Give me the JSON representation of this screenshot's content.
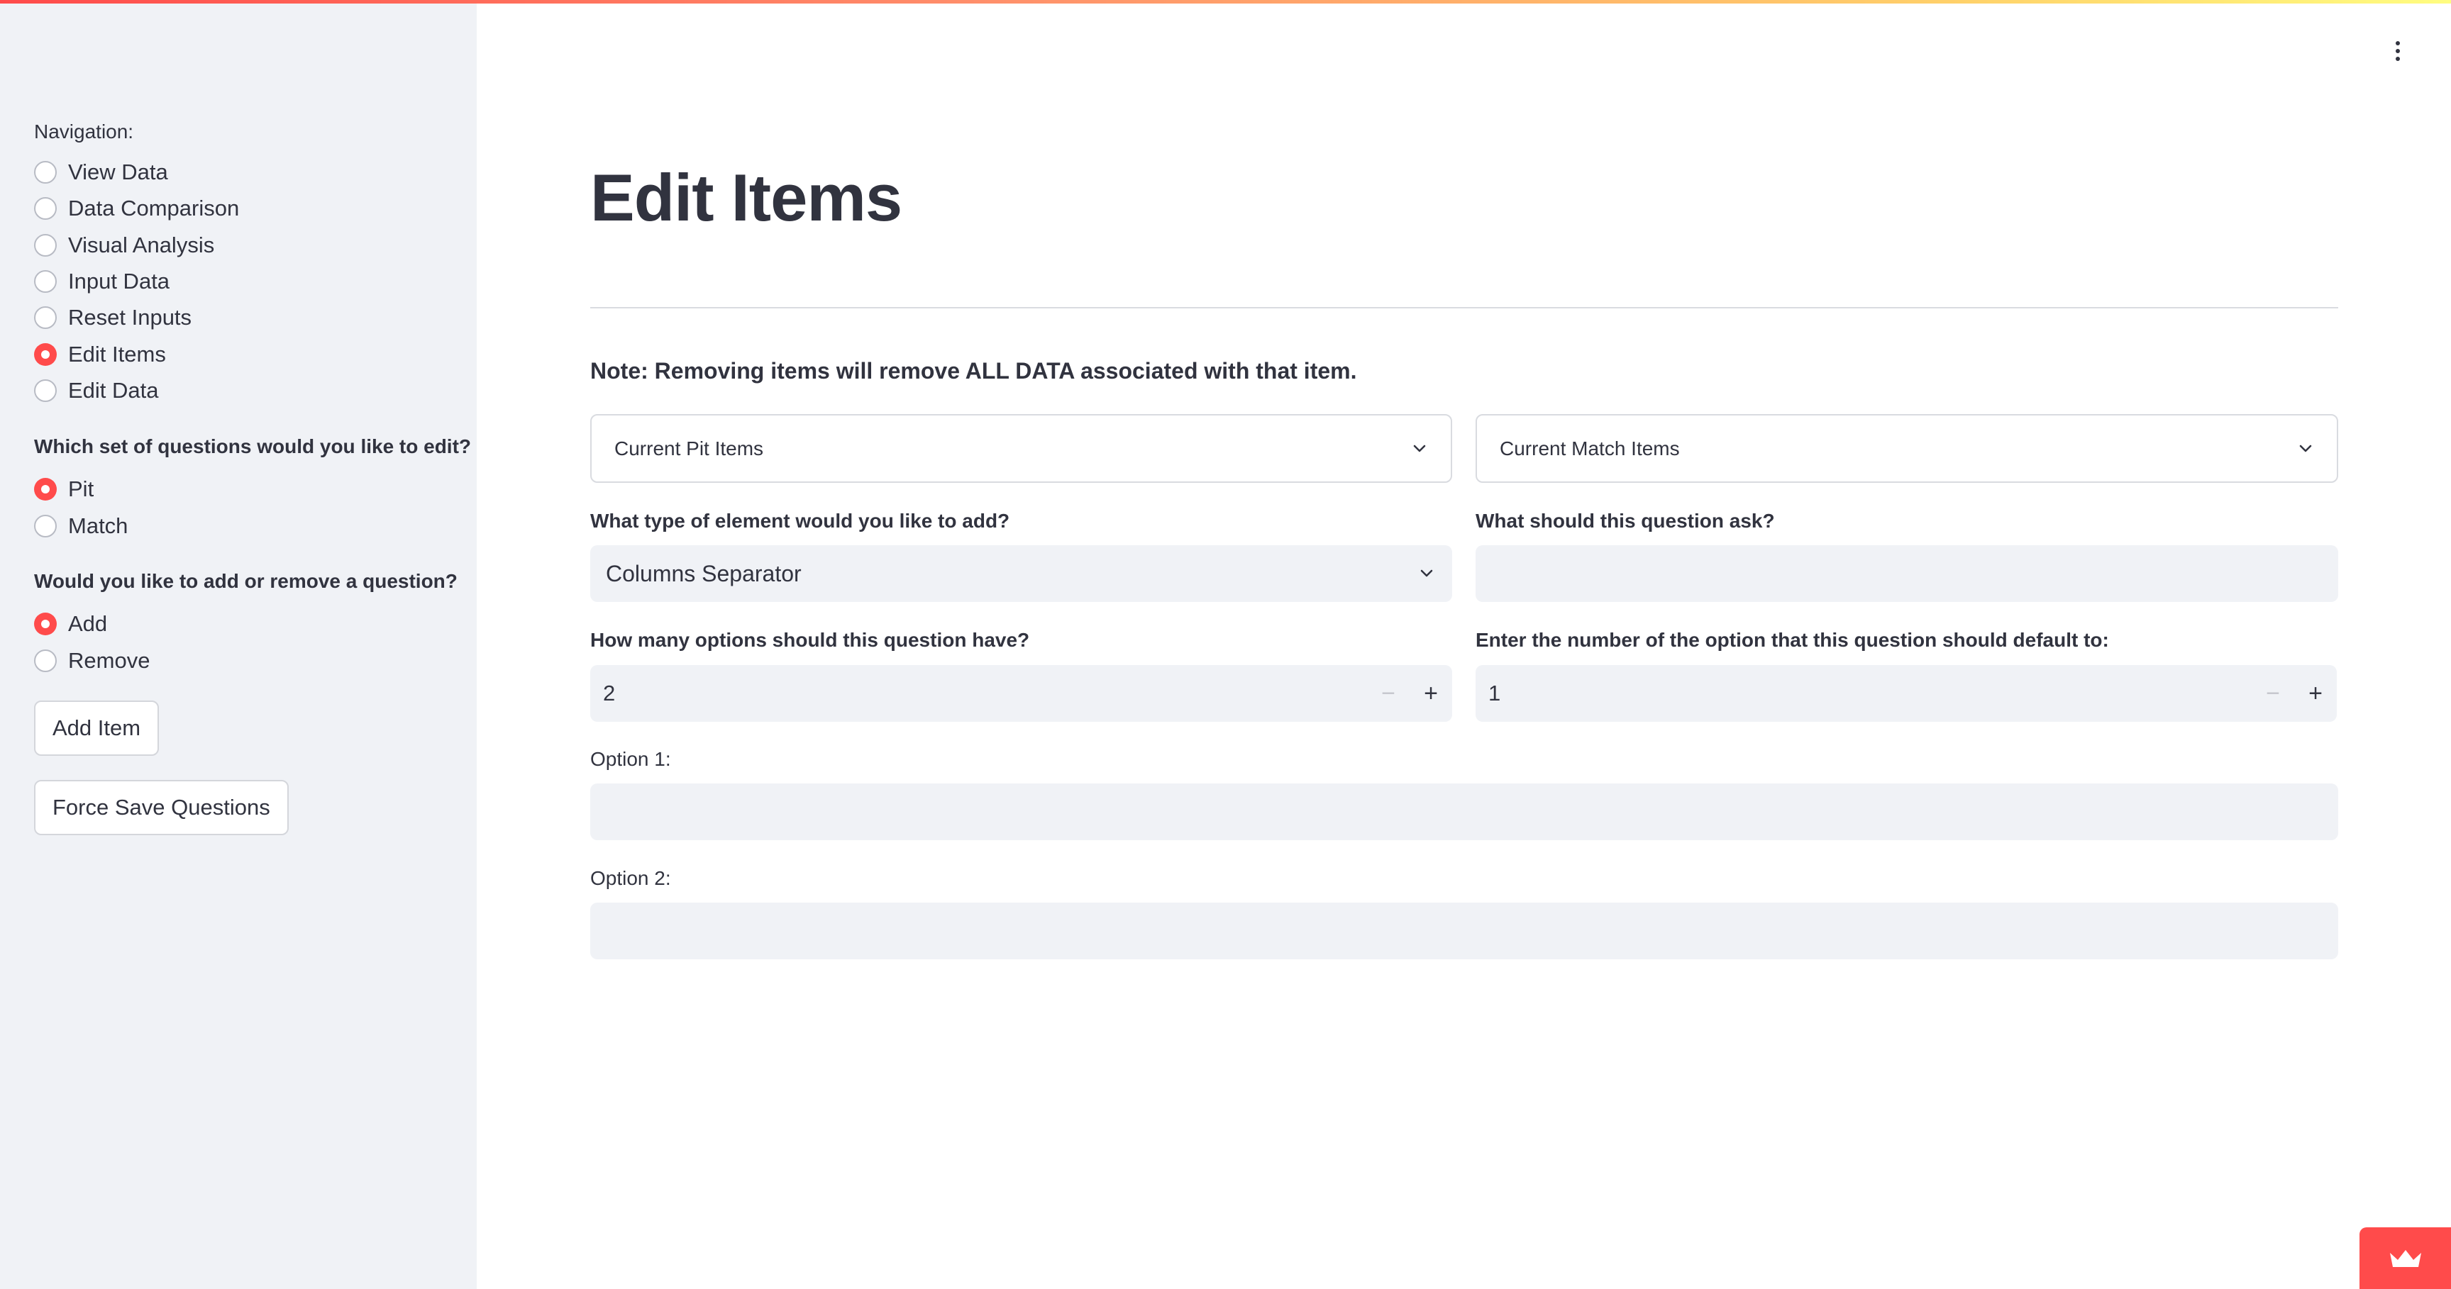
{
  "sidebar": {
    "navigation_label": "Navigation:",
    "nav_items": [
      {
        "label": "View Data",
        "checked": false
      },
      {
        "label": "Data Comparison",
        "checked": false
      },
      {
        "label": "Visual Analysis",
        "checked": false
      },
      {
        "label": "Input Data",
        "checked": false
      },
      {
        "label": "Reset Inputs",
        "checked": false
      },
      {
        "label": "Edit Items",
        "checked": true
      },
      {
        "label": "Edit Data",
        "checked": false
      }
    ],
    "question_set_label": "Which set of questions would you like to edit?",
    "question_set_options": [
      {
        "label": "Pit",
        "checked": true
      },
      {
        "label": "Match",
        "checked": false
      }
    ],
    "add_remove_label": "Would you like to add or remove a question?",
    "add_remove_options": [
      {
        "label": "Add",
        "checked": true
      },
      {
        "label": "Remove",
        "checked": false
      }
    ],
    "add_item_button": "Add Item",
    "force_save_button": "Force Save Questions"
  },
  "main": {
    "title": "Edit Items",
    "note": "Note: Removing items will remove ALL DATA associated with that item.",
    "expanders": {
      "pit": "Current Pit Items",
      "match": "Current Match Items"
    },
    "element_type": {
      "label": "What type of element would you like to add?",
      "value": "Columns Separator"
    },
    "question_ask": {
      "label": "What should this question ask?",
      "value": ""
    },
    "num_options": {
      "label": "How many options should this question have?",
      "value": "2"
    },
    "default_option": {
      "label": "Enter the number of the option that this question should default to:",
      "value": "1"
    },
    "option1": {
      "label": "Option 1:",
      "value": ""
    },
    "option2": {
      "label": "Option 2:",
      "value": ""
    },
    "stepper_minus": "−",
    "stepper_plus": "+"
  },
  "colors": {
    "accent": "#ff4b4b",
    "sidebar_bg": "#f0f2f6",
    "input_bg": "#f0f2f6",
    "text": "#31333f"
  },
  "icons": {
    "menu": "vertical-ellipsis-icon",
    "expander": "chevron-down-icon",
    "select": "chevron-down-icon",
    "deploy": "crown-icon"
  }
}
